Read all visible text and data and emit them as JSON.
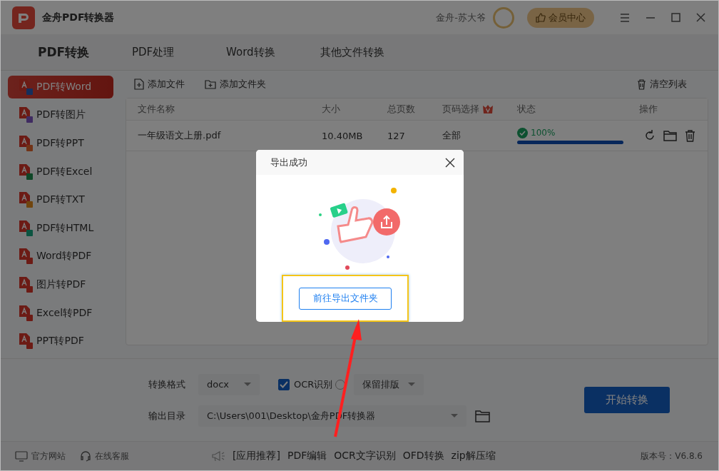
{
  "window": {
    "title": "金舟PDF转换器",
    "user": "金舟-苏大爷",
    "vip_button": "会员中心"
  },
  "tabs": [
    {
      "label": "PDF转换",
      "selected": true
    },
    {
      "label": "PDF处理",
      "selected": false
    },
    {
      "label": "Word转换",
      "selected": false
    },
    {
      "label": "其他文件转换",
      "selected": false
    }
  ],
  "sidebar": {
    "items": [
      {
        "label": "PDF转Word",
        "selected": true
      },
      {
        "label": "PDF转图片",
        "selected": false
      },
      {
        "label": "PDF转PPT",
        "selected": false
      },
      {
        "label": "PDF转Excel",
        "selected": false
      },
      {
        "label": "PDF转TXT",
        "selected": false
      },
      {
        "label": "PDF转HTML",
        "selected": false
      },
      {
        "label": "Word转PDF",
        "selected": false
      },
      {
        "label": "图片转PDF",
        "selected": false
      },
      {
        "label": "Excel转PDF",
        "selected": false
      },
      {
        "label": "PPT转PDF",
        "selected": false
      }
    ]
  },
  "toolbar": {
    "add_file": "添加文件",
    "add_folder": "添加文件夹",
    "clear_list": "清空列表"
  },
  "table": {
    "columns": [
      "文件名称",
      "大小",
      "总页数",
      "页码选择",
      "状态",
      "操作"
    ],
    "rows": [
      {
        "name": "一年级语文上册.pdf",
        "size": "10.40MB",
        "pages": "127",
        "page_range": "全部",
        "status": "100%",
        "level": 1
      }
    ]
  },
  "settings": {
    "format_label": "转换格式",
    "format": "docx",
    "ocr": {
      "label": "OCR识别",
      "checked": true
    },
    "layout": "保留排版",
    "output_label": "输出目录",
    "output_path": "C:\\Users\\001\\Desktop\\金舟PDF转换器",
    "start_button": "开始转换"
  },
  "status_bar": {
    "links": [
      "官方网站",
      "在线客服"
    ],
    "promo": [
      "[应用推荐]",
      "PDF编辑",
      "OCR文字识别",
      "OFD转换",
      "zip解压缩"
    ],
    "version": "版本号：V6.8.6"
  },
  "dialog": {
    "title": "导出成功",
    "button": "前往导出文件夹"
  }
}
